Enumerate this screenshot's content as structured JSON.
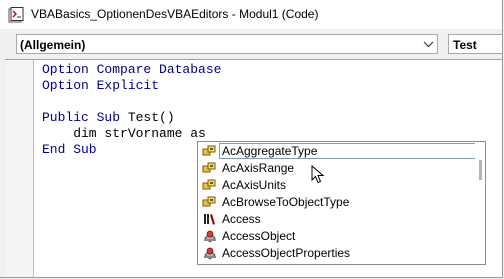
{
  "window": {
    "title": "VBABasics_OptionenDesVBAEditors - Modul1 (Code)"
  },
  "combos": {
    "object": "(Allgemein)",
    "procedure": "Test"
  },
  "code": {
    "lines": [
      {
        "kw": "Option Compare Database",
        "rest": ""
      },
      {
        "kw": "Option Explicit",
        "rest": ""
      },
      {
        "kw": "",
        "rest": ""
      },
      {
        "kw": "Public Sub",
        "rest": " Test()"
      },
      {
        "kw": "",
        "rest": "    dim strVorname as"
      },
      {
        "kw": "End Sub",
        "rest": ""
      }
    ]
  },
  "autocomplete": {
    "items": [
      {
        "label": "AcAggregateType",
        "icon": "enum-icon",
        "selected": true
      },
      {
        "label": "AcAxisRange",
        "icon": "enum-icon"
      },
      {
        "label": "AcAxisUnits",
        "icon": "enum-icon"
      },
      {
        "label": "AcBrowseToObjectType",
        "icon": "enum-icon"
      },
      {
        "label": "Access",
        "icon": "library-icon"
      },
      {
        "label": "AccessObject",
        "icon": "class-icon"
      },
      {
        "label": "AccessObjectProperties",
        "icon": "class-icon"
      }
    ]
  }
}
